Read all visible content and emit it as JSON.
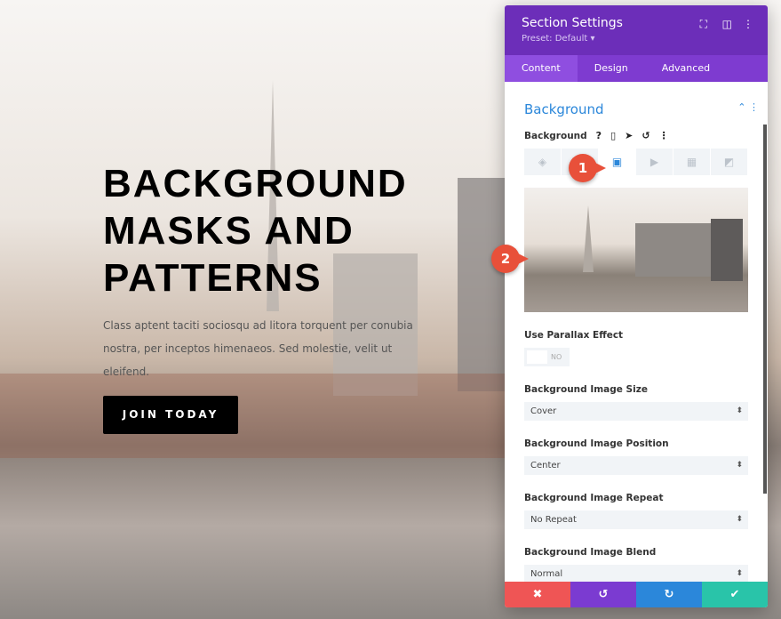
{
  "hero": {
    "title": "BACKGROUND MASKS AND PATTERNS",
    "text": "Class aptent taciti sociosqu ad litora torquent per conubia nostra, per inceptos himenaeos. Sed molestie, velit ut eleifend.",
    "button": "JOIN TODAY"
  },
  "panel": {
    "title": "Section Settings",
    "preset": "Preset: Default ▾",
    "tabs": [
      "Content",
      "Design",
      "Advanced"
    ],
    "active_tab": "Content",
    "section": "Background",
    "bg_label": "Background",
    "parallax": {
      "label": "Use Parallax Effect",
      "value": "NO"
    },
    "fields": [
      {
        "label": "Background Image Size",
        "value": "Cover"
      },
      {
        "label": "Background Image Position",
        "value": "Center"
      },
      {
        "label": "Background Image Repeat",
        "value": "No Repeat"
      },
      {
        "label": "Background Image Blend",
        "value": "Normal"
      }
    ],
    "footer_colors": [
      "#ef5555",
      "#7b3bd1",
      "#2b87da",
      "#29c4a9"
    ]
  },
  "badges": [
    "1",
    "2"
  ]
}
